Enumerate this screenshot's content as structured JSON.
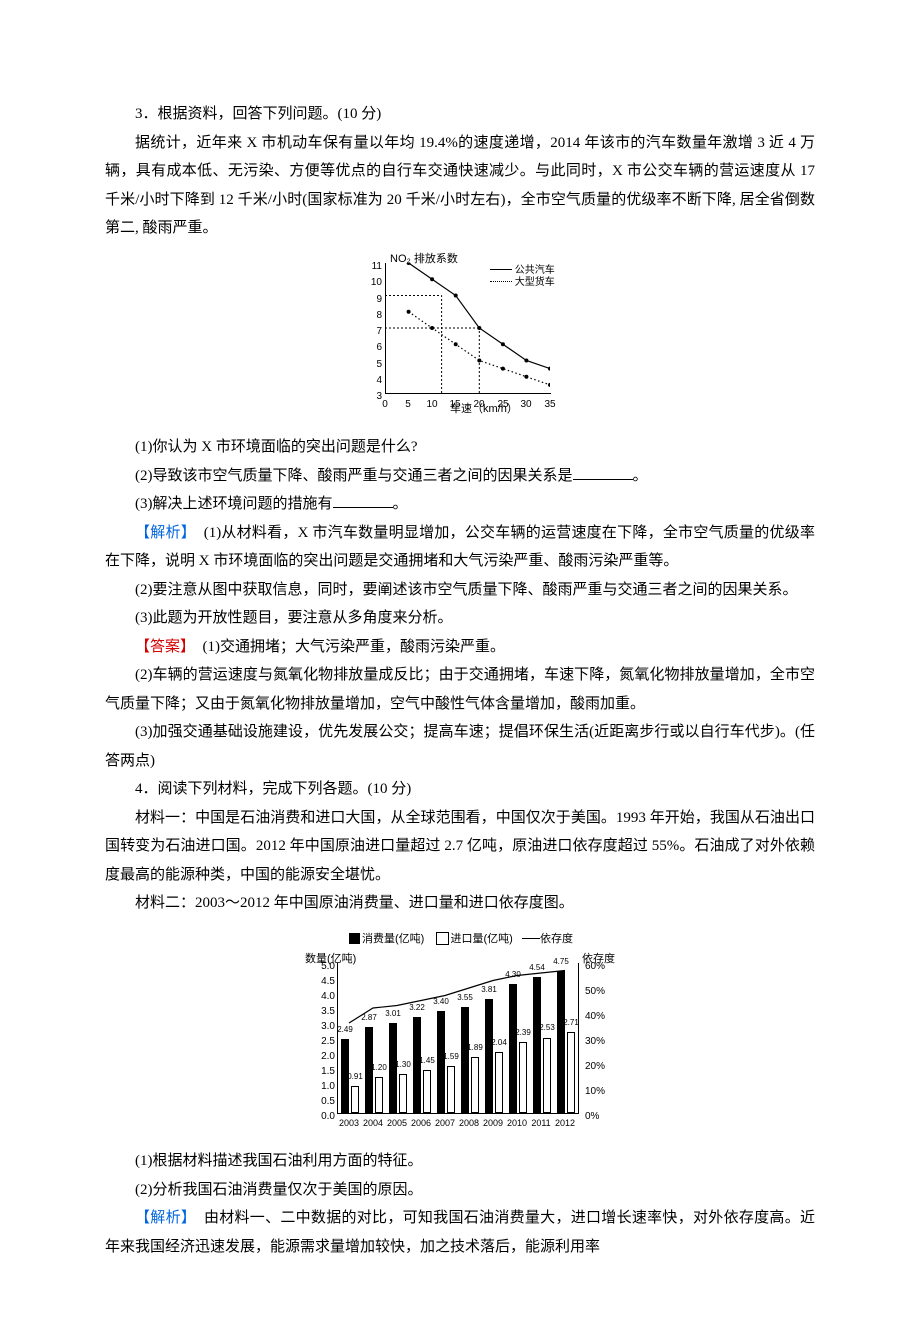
{
  "q3_title": "3．根据资料，回答下列问题。(10 分)",
  "q3_passage": "据统计，近年来 X 市机动车保有量以年均 19.4%的速度递增，2014 年该市的汽车数量年激增 3 近 4 万辆，具有成本低、无污染、方便等优点的自行车交通快速减少。与此同时，X 市公交车辆的营运速度从 17 千米/小时下降到 12 千米/小时(国家标准为 20 千米/小时左右)，全市空气质量的优级率不断下降, 居全省倒数第二, 酸雨严重。",
  "q3_sub1": "(1)你认为 X 市环境面临的突出问题是什么?",
  "q3_sub2_pre": "(2)导致该市空气质量下降、酸雨严重与交通三者之间的因果关系是",
  "q3_sub2_post": "。",
  "q3_sub3_pre": "(3)解决上述环境问题的措施有",
  "q3_sub3_post": "。",
  "exp_label": "【解析】",
  "q3_exp1": "(1)从材料看，X 市汽车数量明显增加，公交车辆的运营速度在下降，全市空气质量的优级率在下降，说明 X 市环境面临的突出问题是交通拥堵和大气污染严重、酸雨污染严重等。",
  "q3_exp2": "(2)要注意从图中获取信息，同时，要阐述该市空气质量下降、酸雨严重与交通三者之间的因果关系。",
  "q3_exp3": "(3)此题为开放性题目，要注意从多角度来分析。",
  "ans_label": "【答案】",
  "q3_ans1": "(1)交通拥堵；大气污染严重，酸雨污染严重。",
  "q3_ans2": "(2)车辆的营运速度与氮氧化物排放量成反比；由于交通拥堵，车速下降，氮氧化物排放量增加，全市空气质量下降；又由于氮氧化物排放量增加，空气中酸性气体含量增加，酸雨加重。",
  "q3_ans3": "(3)加强交通基础设施建设，优先发展公交；提高车速；提倡环保生活(近距离步行或以自行车代步)。(任答两点)",
  "q4_title": "4．阅读下列材料，完成下列各题。(10 分)",
  "q4_m1": "材料一：中国是石油消费和进口大国，从全球范围看，中国仅次于美国。1993 年开始，我国从石油出口国转变为石油进口国。2012 年中国原油进口量超过 2.7 亿吨，原油进口依存度超过 55%。石油成了对外依赖度最高的能源种类，中国的能源安全堪忧。",
  "q4_m2": "材料二：2003～2012 年中国原油消费量、进口量和进口依存度图。",
  "q4_sub1": "(1)根据材料描述我国石油利用方面的特征。",
  "q4_sub2": "(2)分析我国石油消费量仅次于美国的原因。",
  "q4_exp": "由材料一、二中数据的对比，可知我国石油消费量大，进口增长速率快，对外依存度高。近年来我国经济迅速发展，能源需求量增加较快，加之技术落后，能源利用率",
  "chart_data": [
    {
      "type": "line",
      "title": "",
      "xlabel": "车速（km/h）",
      "ylabel": "NO₂ 排放系数",
      "xlim": [
        0,
        35
      ],
      "ylim": [
        3,
        11
      ],
      "xticks": [
        0,
        5,
        10,
        15,
        20,
        25,
        30,
        35
      ],
      "yticks": [
        3,
        4,
        5,
        6,
        7,
        8,
        9,
        10,
        11
      ],
      "series": [
        {
          "name": "公共汽车",
          "style": "solid",
          "x": [
            5,
            10,
            15,
            20,
            25,
            30,
            35
          ],
          "y": [
            11,
            10,
            9,
            7,
            6,
            5,
            4.5
          ]
        },
        {
          "name": "大型货车",
          "style": "dotted",
          "x": [
            5,
            10,
            15,
            20,
            25,
            30,
            35
          ],
          "y": [
            8,
            7,
            6,
            5,
            4.5,
            4,
            3.5
          ]
        }
      ],
      "guides": [
        {
          "from": [
            12,
            3
          ],
          "to": [
            12,
            9
          ]
        },
        {
          "from": [
            0,
            9
          ],
          "to": [
            12,
            9
          ]
        },
        {
          "from": [
            20,
            3
          ],
          "to": [
            20,
            7
          ]
        },
        {
          "from": [
            0,
            7
          ],
          "to": [
            20,
            7
          ]
        }
      ]
    },
    {
      "type": "combo",
      "legend": [
        "消费量(亿吨)",
        "进口量(亿吨)",
        "依存度"
      ],
      "ytitle_left": "数量(亿吨)",
      "ytitle_right": "依存度",
      "categories": [
        "2003",
        "2004",
        "2005",
        "2006",
        "2007",
        "2008",
        "2009",
        "2010",
        "2011",
        "2012"
      ],
      "yl_ticks": [
        0,
        0.5,
        1.0,
        1.5,
        2.0,
        2.5,
        3.0,
        3.5,
        4.0,
        4.5,
        5.0
      ],
      "yr_ticks": [
        "0%",
        "10%",
        "20%",
        "30%",
        "40%",
        "50%",
        "60%"
      ],
      "yl_lim": [
        0,
        5.0
      ],
      "yr_lim": [
        0,
        60
      ],
      "series": [
        {
          "name": "消费量",
          "values": [
            2.49,
            2.87,
            3.01,
            3.22,
            3.4,
            3.55,
            3.81,
            4.3,
            4.54,
            4.75
          ]
        },
        {
          "name": "进口量",
          "values": [
            0.91,
            1.2,
            1.3,
            1.45,
            1.59,
            1.89,
            2.04,
            2.39,
            2.53,
            2.71
          ]
        },
        {
          "name": "依存度",
          "values": [
            36,
            42,
            43,
            45,
            47,
            50,
            53,
            55,
            56,
            57
          ]
        }
      ]
    }
  ],
  "c1": {
    "yt": "NO₂ 排放系数",
    "xt": "车速（km/h）",
    "leg1": "公共汽车",
    "leg2": "大型货车"
  },
  "c2": {
    "leg1": "消费量(亿吨)",
    "leg2": "进口量(亿吨)",
    "leg3": "依存度",
    "ytl": "数量(亿吨)",
    "ytr": "依存度"
  }
}
